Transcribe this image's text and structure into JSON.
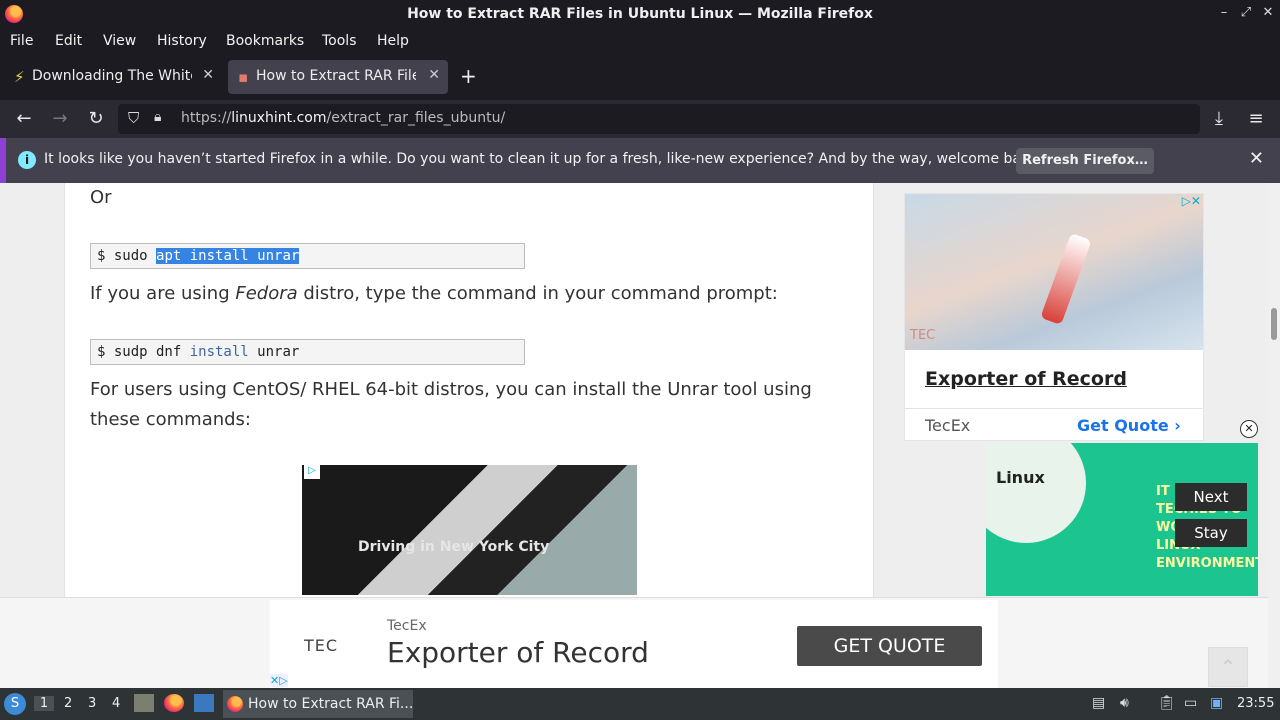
{
  "window": {
    "title": "How to Extract RAR Files in Ubuntu Linux — Mozilla Firefox"
  },
  "menu": [
    "File",
    "Edit",
    "View",
    "History",
    "Bookmarks",
    "Tools",
    "Help"
  ],
  "tabs": [
    {
      "label": "Downloading The White H",
      "active": false
    },
    {
      "label": "How to Extract RAR Files i",
      "active": true
    }
  ],
  "url": {
    "prefix": "https://",
    "domain": "linuxhint.com",
    "path": "/extract_rar_files_ubuntu/"
  },
  "notification": {
    "text": "It looks like you haven’t started Firefox in a while. Do you want to clean it up for a fresh, like-new experience? And by the way, welcome back!",
    "button": "Refresh Firefox…"
  },
  "article": {
    "or_text": "Or",
    "code1": {
      "prompt": "$ sudo ",
      "selected": "apt install unrar"
    },
    "fedora_text_pre": "If you are using ",
    "fedora_text_em": "Fedora",
    "fedora_text_post": " distro, type the command in your command prompt:",
    "code2": {
      "prompt": "$ sudp dnf ",
      "keyword": "install",
      "rest": " unrar"
    },
    "centos_text": "For users using CentOS/ RHEL 64-bit distros, you can install the Unrar tool using these commands:",
    "video_caption": "Driving in New York City"
  },
  "side_ad": {
    "logo": "TEC",
    "headline": "Exporter of Record",
    "brand": "TecEx",
    "cta": "Get Quote"
  },
  "float_ad": {
    "logo": "Linux",
    "slogan": "IT IS FOR TECHIES TO WORK IN A LINUX ENVIRONMENT",
    "next": "Next",
    "stay": "Stay"
  },
  "bottom_ad": {
    "logo": "TEC",
    "brand": "TecEx",
    "headline": "Exporter of Record",
    "cta": "GET QUOTE"
  },
  "taskbar": {
    "workspaces": [
      "1",
      "2",
      "3",
      "4"
    ],
    "task_label": "How to Extract RAR Fi...",
    "clock": "23:55"
  }
}
